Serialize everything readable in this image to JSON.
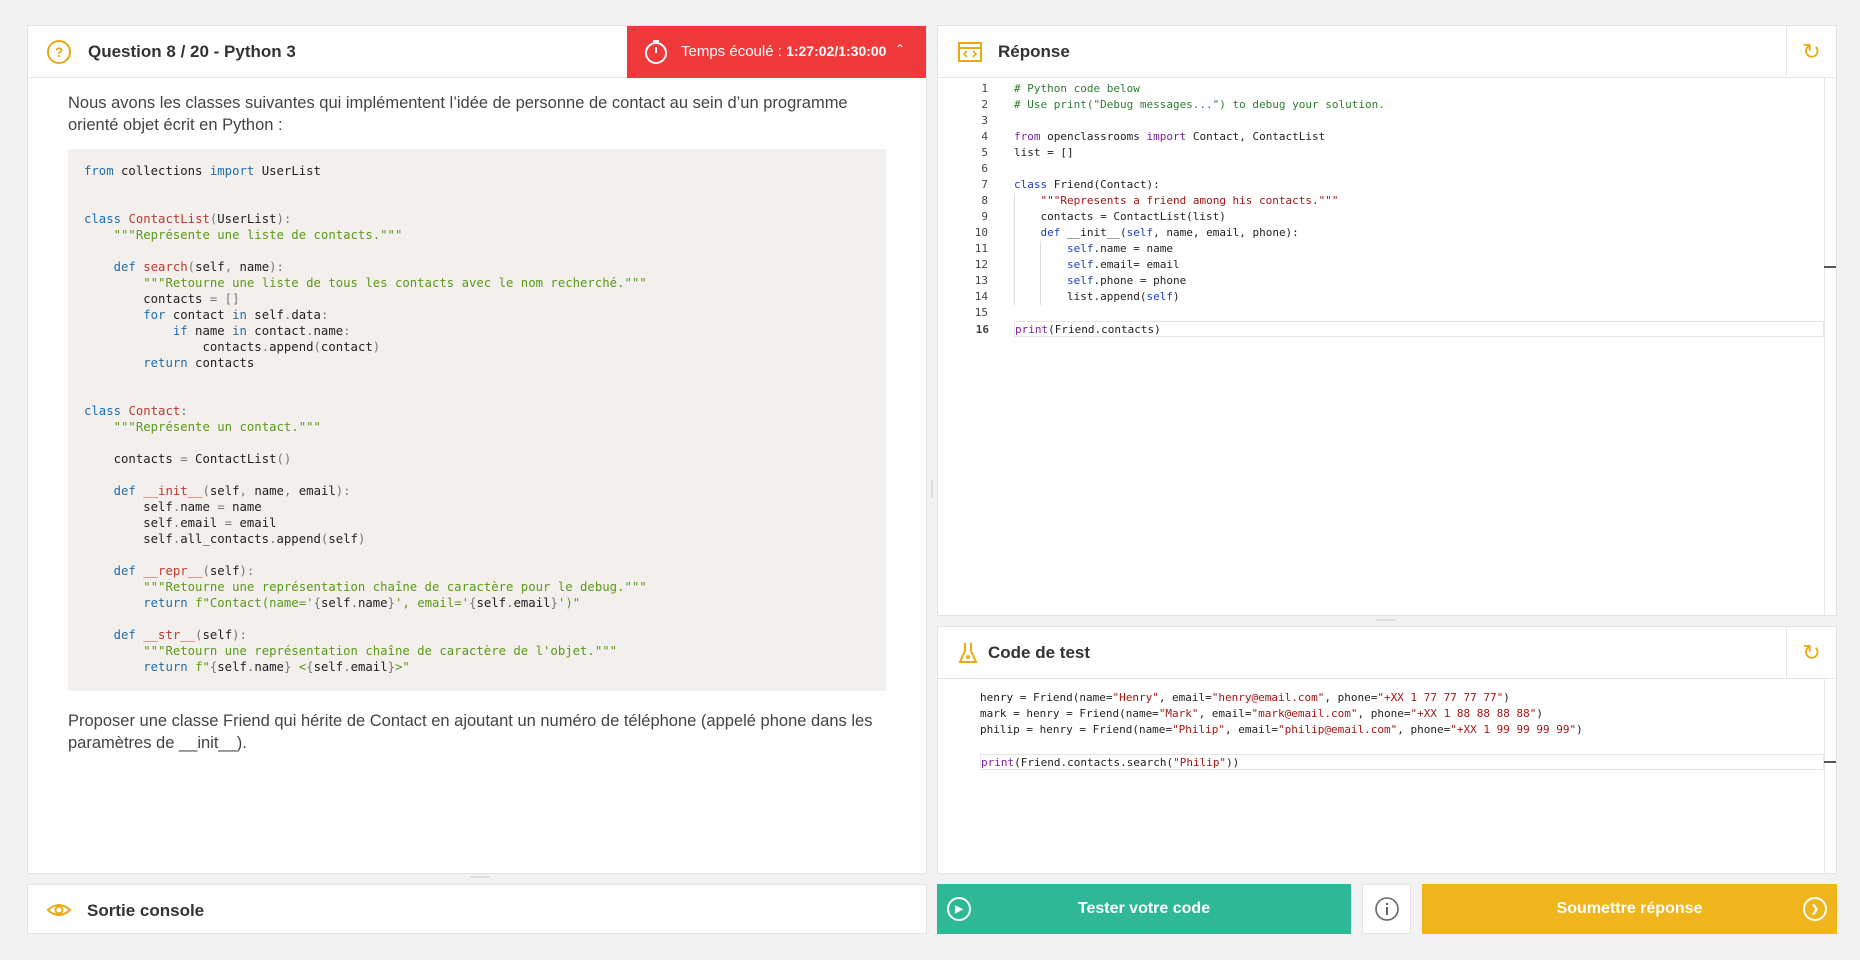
{
  "question": {
    "title": "Question 8 / 20 - Python 3",
    "timer_label": "Temps écoulé : ",
    "timer_value": "1:27:02/1:30:00",
    "intro": "Nous avons les classes suivantes qui implémentent l’idée de personne de contact au sein d’un programme orienté objet écrit en Python :",
    "outro": "Proposer une classe Friend qui hérite de Contact en ajoutant un numéro de téléphone (appelé phone dans les paramètres de __init__)."
  },
  "response": {
    "title": "Réponse",
    "lines": [
      "# Python code below",
      "# Use print(\"Debug messages...\") to debug your solution.",
      "",
      "from openclassrooms import Contact, ContactList",
      "list = []",
      "",
      "class Friend(Contact):",
      "    \"\"\"Represents a friend among his contacts.\"\"\"",
      "    contacts = ContactList(list)",
      "    def __init__(self, name, email, phone):",
      "        self.name = name",
      "        self.email= email",
      "        self.phone = phone",
      "        list.append(self)",
      "",
      "print(Friend.contacts)"
    ]
  },
  "test": {
    "title": "Code de test",
    "lines": [
      "henry = Friend(name=\"Henry\", email=\"henry@email.com\", phone=\"+XX 1 77 77 77 77\")",
      "mark = henry = Friend(name=\"Mark\", email=\"mark@email.com\", phone=\"+XX 1 88 88 88 88\")",
      "philip = henry = Friend(name=\"Philip\", email=\"philip@email.com\", phone=\"+XX 1 99 99 99 99\")",
      "",
      "print(Friend.contacts.search(\"Philip\"))"
    ]
  },
  "console": {
    "title": "Sortie console"
  },
  "buttons": {
    "test": "Tester votre code",
    "submit": "Soumettre réponse"
  },
  "colors": {
    "timer": "#f0393a",
    "test_button": "#2fb896",
    "submit_button": "#f0b51c",
    "accent_icon": "#e8a913"
  },
  "icons": [
    "question-icon",
    "timer-icon",
    "code-window-icon",
    "refresh-icon",
    "flask-icon",
    "eye-icon",
    "play-icon",
    "info-icon",
    "arrow-right-icon"
  ]
}
